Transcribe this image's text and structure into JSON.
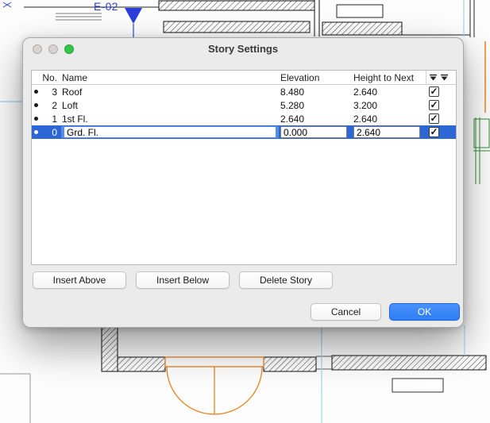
{
  "colors": {
    "selection": "#2d66d5",
    "ok_button": "#2d7ff7",
    "plan_orange": "#e8831f",
    "plan_green": "#2e8b34",
    "plan_cyan": "#9fd4ea",
    "plan_blue": "#2b3fd8"
  },
  "icons": {
    "check": "✓"
  },
  "background": {
    "section_marker_label": "E-02"
  },
  "dialog": {
    "title": "Story Settings",
    "table": {
      "columns": {
        "no": "No.",
        "name": "Name",
        "elevation": "Elevation",
        "height": "Height to Next"
      },
      "rows": [
        {
          "no": "3",
          "name": "Roof",
          "elevation": "8.480",
          "height": "2.640",
          "checked": true,
          "selected": false
        },
        {
          "no": "2",
          "name": "Loft",
          "elevation": "5.280",
          "height": "3.200",
          "checked": true,
          "selected": false
        },
        {
          "no": "1",
          "name": "1st Fl.",
          "elevation": "2.640",
          "height": "2.640",
          "checked": true,
          "selected": false
        },
        {
          "no": "0",
          "name": "Grd. Fl.",
          "elevation": "0.000",
          "height": "2.640",
          "checked": true,
          "selected": true
        }
      ]
    },
    "buttons": {
      "insert_above": "Insert Above",
      "insert_below": "Insert Below",
      "delete_story": "Delete Story",
      "cancel": "Cancel",
      "ok": "OK"
    }
  }
}
